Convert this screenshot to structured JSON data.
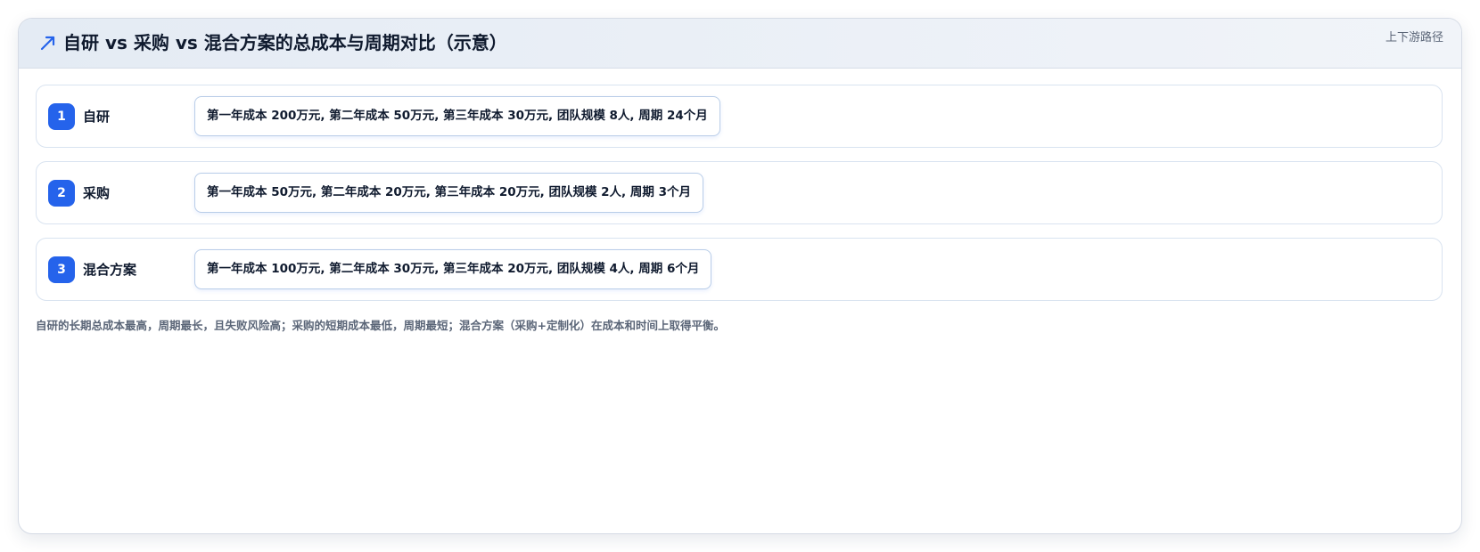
{
  "header": {
    "icon": "trend-arrow-icon",
    "title": "自研 vs 采购 vs 混合方案的总成本与周期对比（示意）",
    "tag": "上下游路径",
    "accent_color": "#2563eb"
  },
  "rows": [
    {
      "index": "1",
      "label": "自研",
      "value": "第一年成本 200万元, 第二年成本 50万元, 第三年成本 30万元, 团队规模 8人, 周期 24个月"
    },
    {
      "index": "2",
      "label": "采购",
      "value": "第一年成本 50万元, 第二年成本 20万元, 第三年成本 20万元, 团队规模 2人, 周期 3个月"
    },
    {
      "index": "3",
      "label": "混合方案",
      "value": "第一年成本 100万元, 第二年成本 30万元, 第三年成本 20万元, 团队规模 4人, 周期 6个月"
    }
  ],
  "footnote": "自研的长期总成本最高，周期最长，且失败风险高；采购的短期成本最低，周期最短；混合方案（采购+定制化）在成本和时间上取得平衡。"
}
